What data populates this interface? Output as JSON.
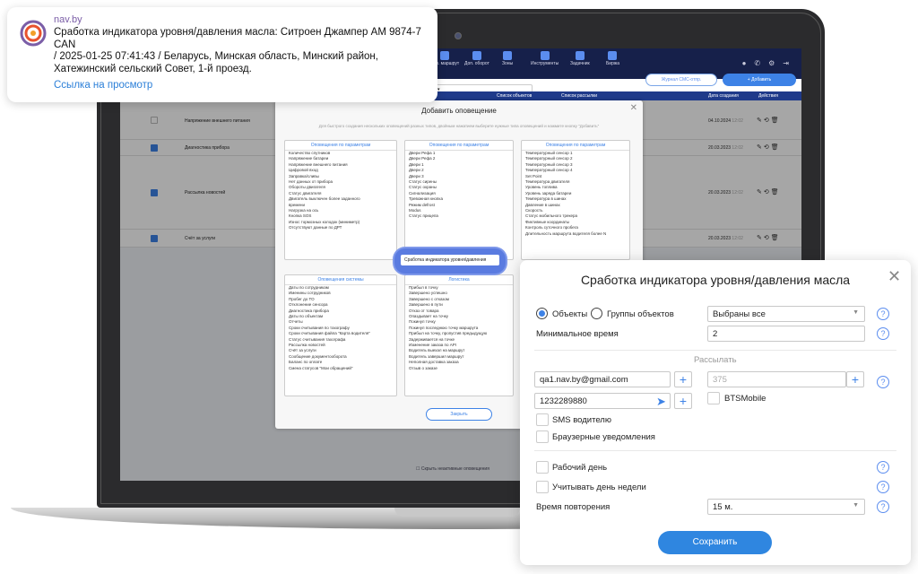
{
  "notification": {
    "source": "nav.by",
    "message": "Сработка индикатора уровня/давления масла: Ситроен Джампер АМ 9874-7 CAN\n / 2025-01-25 07:41:43 / Беларусь, Минская область, Минский район, Хатежинский сельский Совет,  1-й проезд.",
    "link": "Ссылка на просмотр"
  },
  "screen": {
    "topbar": {
      "nav_items": [
        "Отп. маршрут",
        "Доп. оборот",
        "Зоны",
        "Инструменты",
        "Задачник",
        "Биржа"
      ],
      "right_icons": [
        "ru-badge",
        "phone-icon",
        "gear-icon",
        "logout-icon"
      ]
    },
    "toolbar": {
      "select_label": "",
      "sms_button": "Журнал СМС-отпр.",
      "add_button": "Добавить"
    },
    "table": {
      "headers": [
        "Список объектов",
        "Список рассылки",
        "Дата создания",
        "Действия"
      ],
      "rows": [
        {
          "name": "Напряжение внешнего питания",
          "date": "04.10.2024",
          "time": "12:02",
          "checked": false
        },
        {
          "name": "Диагностика прибора",
          "date": "20.03.2023",
          "time": "12:02",
          "checked": true
        },
        {
          "name": "Рассылка новостей",
          "date": "20.03.2023",
          "time": "12:02",
          "checked": true
        },
        {
          "name": "Счёт за услуги",
          "date": "20.03.2023",
          "time": "12:02",
          "checked": true
        }
      ],
      "footer_note": "Скрыть неактивные оповещения"
    },
    "modal": {
      "title": "Добавить оповещение",
      "subtitle": "Для быстрого создания нескольких оповещений разных типов, двойным нажатием выберите нужные типа оповещений и нажмите кнопку \"Добавить\"",
      "columns": [
        {
          "header": "Оповещения по параметрам",
          "items": [
            "Количество спутников",
            "Напряжение батареи",
            "Напряжение внешнего питания",
            "Цифровой вход",
            "Заправка/сливы",
            "Нет данных от прибора",
            "Обороты двигателя",
            "Статус двигателя",
            "Двигатель выключен более заданного",
            "времени",
            "Нагрузка на ось",
            "Кнопка SOS",
            "Износ тормозных колодок (миниметр)",
            "Отсутствуют данные по ДРТ"
          ]
        },
        {
          "header": "Оповещения по параметрам",
          "items": [
            "Двери Рефа 1",
            "Двери Рефа 2",
            "Двери 1",
            "Двери 2",
            "Двери 3",
            "Статус сирены",
            "Статус охраны",
            "Сигнализация",
            "Тревожная кнопка",
            "Режим defrost",
            "Modus",
            "Статус прицепа"
          ]
        },
        {
          "header": "Оповещения по параметрам",
          "items": [
            "Температурный сенсор 1",
            "Температурный сенсор 2",
            "Температурный сенсор 3",
            "Температурный сенсор 4",
            "Set Point",
            "Температура двигателя",
            "Уровень топлива",
            "Уровень заряда батареи",
            "Температура в шинах",
            "Давление в шинах",
            "Скорость",
            "Статус мобильного трекера",
            "Фиктивные координаты",
            "Контроль суточного пробега",
            "Длительность маршрута водителя более N"
          ]
        },
        {
          "header": "Оповещения системы",
          "items": [
            "Даты по сотрудникам",
            "Именины сотрудников",
            "Пробег до ТО",
            "Отклонение сенсора",
            "Диагностика прибора",
            "Даты по объектам",
            "Отчеты",
            "Сроки считывания по тахографу",
            "Сроки считывания файла \"Карта водителя\"",
            "Статус считывания тахографа",
            "Рассылка новостей",
            "Счёт за услуги",
            "Сообщение документооборота",
            "Баланс по оплате",
            "Смена статусов \"Мои обращений\""
          ]
        },
        {
          "header": "Логистика",
          "items": [
            "Прибыл в точку",
            "Завершено успешно",
            "Завершено с отказом",
            "Завершено в пути",
            "Отказ от товара",
            "Опаздывает на точку",
            "Покинул точку",
            "Покинул последнюю точку маршрута",
            "Прибыл на точку, пропустив предыдущую",
            "Задерживается на точке",
            "Изменение заказа по API",
            "Водитель выехал на маршрут",
            "Водитель завершил маршрут",
            "Неполная доставка заказа",
            "Отзыв о заказе"
          ]
        }
      ],
      "close_button": "Закрыть",
      "highlighted_item": "Сработка индикатора уровня/давления"
    }
  },
  "dialog": {
    "title": "Сработка индикатора уровня/давления масла",
    "radio_objects": "Объекты",
    "radio_groups": "Группы объектов",
    "objects_select": "Выбраны все",
    "min_time_label": "Минимальное время",
    "min_time_value": "2",
    "send_label": "Рассылать",
    "email_value": "qa1.nav.by@gmail.com",
    "phone_value": "1232289880",
    "number_placeholder": "375",
    "bts_label": "BTSMobile",
    "sms_driver_label": "SMS водителю",
    "browser_label": "Браузерные уведомления",
    "workday_label": "Рабочий день",
    "weekday_label": "Учитывать день недели",
    "repeat_label": "Время повторения",
    "repeat_value": "15 м.",
    "save_button": "Сохранить",
    "help_glyph": "?",
    "plus_glyph": "+",
    "close_glyph": "✕"
  },
  "colors": {
    "accent": "#2f86e0",
    "navy": "#16204a",
    "link": "#2b7fd8",
    "brand": "#7b5ea7"
  }
}
